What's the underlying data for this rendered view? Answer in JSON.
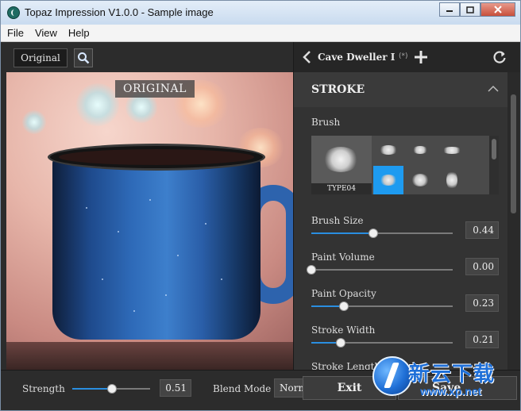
{
  "window": {
    "title": "Topaz Impression V1.0.0 - Sample image",
    "controls": [
      "minimize",
      "maximize",
      "close"
    ]
  },
  "menu": {
    "items": [
      {
        "label": "File"
      },
      {
        "label": "View"
      },
      {
        "label": "Help"
      }
    ]
  },
  "toolbar": {
    "original_button": "Original",
    "zoom_icon": "zoom-icon"
  },
  "canvas": {
    "overlay_label": "ORIGINAL"
  },
  "preset": {
    "name": "Cave Dweller I",
    "marker": "(*)"
  },
  "panel": {
    "section_title": "STROKE",
    "brush": {
      "label": "Brush",
      "selected_name": "TYPE04",
      "cells": [
        {
          "name": "brush-1",
          "selected": false
        },
        {
          "name": "brush-2",
          "selected": false
        },
        {
          "name": "brush-3",
          "selected": false
        },
        {
          "name": "brush-4",
          "selected": true
        },
        {
          "name": "brush-5",
          "selected": false
        },
        {
          "name": "brush-6",
          "selected": false
        }
      ]
    },
    "sliders": [
      {
        "label": "Brush Size",
        "value": "0.44",
        "level": 0.44
      },
      {
        "label": "Paint Volume",
        "value": "0.00",
        "level": 0.0
      },
      {
        "label": "Paint Opacity",
        "value": "0.23",
        "level": 0.23
      },
      {
        "label": "Stroke Width",
        "value": "0.21",
        "level": 0.21
      },
      {
        "label": "Stroke Length",
        "value": "",
        "level": null
      }
    ]
  },
  "bottom": {
    "strength_label": "Strength",
    "strength_value": "0.51",
    "strength_level": 0.51,
    "blend_label": "Blend Mode",
    "blend_value": "Norm",
    "exit_label": "Exit",
    "save_label": "Save"
  },
  "watermark": {
    "chinese": "新云下载",
    "url": "www.xp.net"
  },
  "colors": {
    "accent": "#2a8ee0",
    "selected_brush": "#1e9bf0",
    "panel_bg": "#333333"
  }
}
